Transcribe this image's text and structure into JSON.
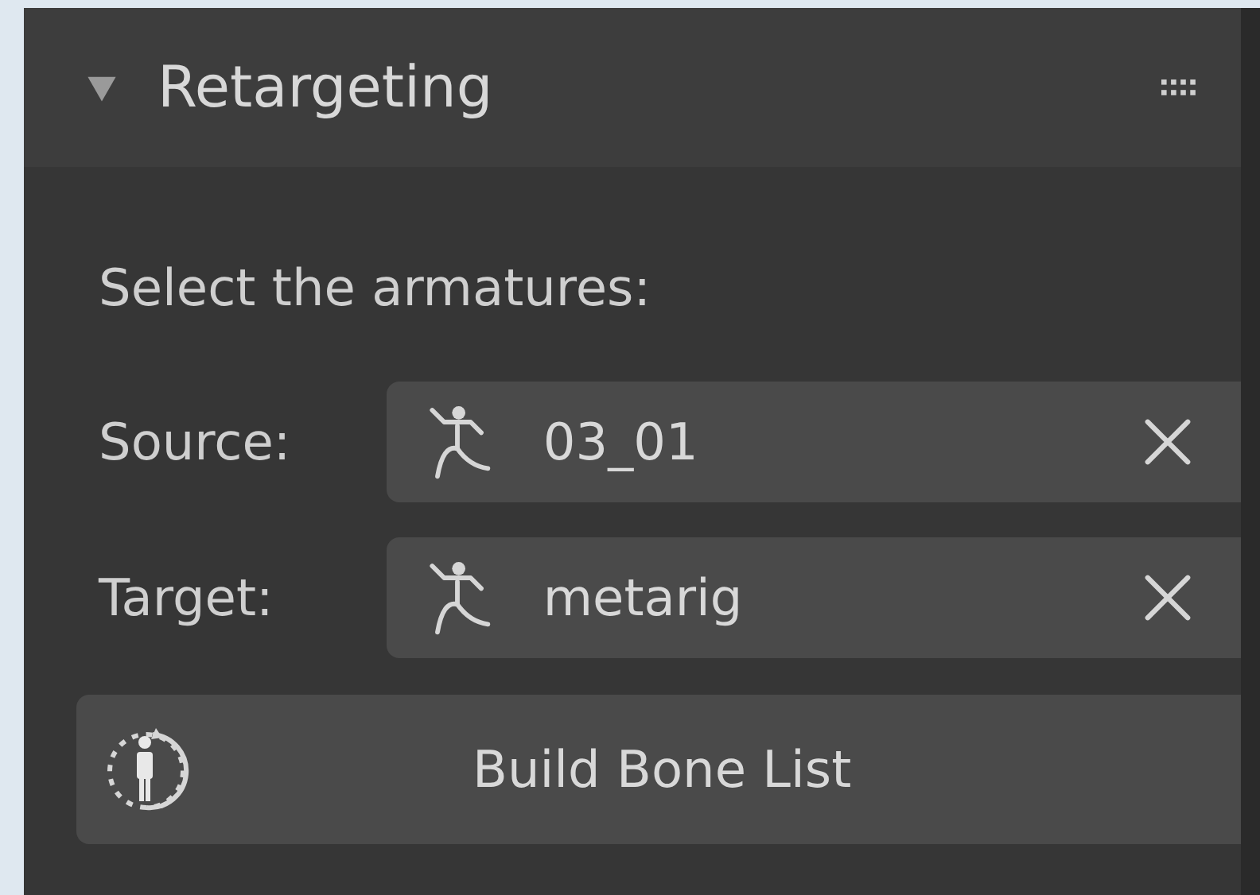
{
  "panel": {
    "title": "Retargeting",
    "expanded": true
  },
  "prompt": "Select the armatures:",
  "fields": [
    {
      "label": "Source:",
      "value": "03_01"
    },
    {
      "label": "Target:",
      "value": "metarig"
    }
  ],
  "button": {
    "label": "Build Bone List"
  }
}
